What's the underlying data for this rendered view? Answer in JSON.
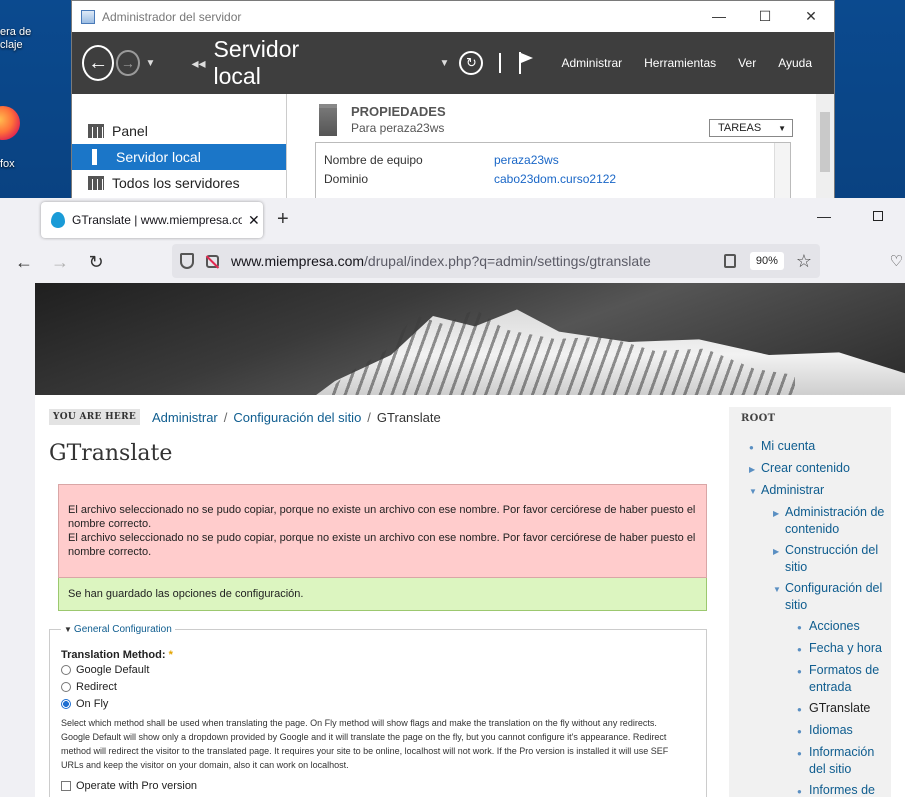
{
  "desktop": {
    "icon1_label_line1": "era de",
    "icon1_label_line2": "claje",
    "icon2_label": "fox"
  },
  "server_manager": {
    "window_title": "Administrador del servidor",
    "window_controls": [
      "—",
      "☐",
      "✕"
    ],
    "breadcrumb": "Servidor local",
    "menu": [
      "Administrar",
      "Herramientas",
      "Ver",
      "Ayuda"
    ],
    "sidebar": [
      {
        "label": "Panel",
        "active": false
      },
      {
        "label": "Servidor local",
        "active": true
      },
      {
        "label": "Todos los servidores",
        "active": false
      }
    ],
    "properties_title": "PROPIEDADES",
    "properties_subtitle": "Para peraza23ws",
    "tasks_label": "TAREAS",
    "properties": [
      {
        "key": "Nombre de equipo",
        "value": "peraza23ws"
      },
      {
        "key": "Dominio",
        "value": "cabo23dom.curso2122"
      }
    ]
  },
  "browser": {
    "tab_title": "GTranslate | www.miempresa.com",
    "url_host": "www.miempresa.com",
    "url_path": "/drupal/index.php?q=admin/settings/gtranslate",
    "zoom": "90%"
  },
  "page": {
    "you_are_here": "YOU ARE HERE",
    "breadcrumb": [
      "Administrar",
      "Configuración del sitio"
    ],
    "breadcrumb_current": "GTranslate",
    "title": "GTranslate",
    "error_messages": [
      "El archivo seleccionado no se pudo copiar, porque no existe un archivo con ese nombre. Por favor cerciórese de haber puesto el nombre correcto.",
      "El archivo seleccionado no se pudo copiar, porque no existe un archivo con ese nombre. Por favor cerciórese de haber puesto el nombre correcto."
    ],
    "status_message": "Se han guardado las opciones de configuración.",
    "fieldset_legend": "General Configuration",
    "translation_method_label": "Translation Method:",
    "required_marker": "*",
    "methods": [
      {
        "label": "Google Default",
        "selected": false
      },
      {
        "label": "Redirect",
        "selected": false
      },
      {
        "label": "On Fly",
        "selected": true
      }
    ],
    "method_description": "Select which method shall be used when translating the page. On Fly method will show flags and make the translation on the fly without any redirects. Google Default will show only a dropdown provided by Google and it will translate the page on the fly, but you cannot configure it's appearance. Redirect method will redirect the visitor to the translated page. It requires your site to be online, localhost will not work. If the Pro version is installed it will use SEF URLs and keep the visitor on your domain, also it can work on localhost.",
    "next_checkbox_label": "Operate with Pro version"
  },
  "sidebar": {
    "root": "ROOT",
    "items": [
      {
        "label": "Mi cuenta",
        "marker": "●",
        "level": 0
      },
      {
        "label": "Crear contenido",
        "marker": "▶",
        "level": 0
      },
      {
        "label": "Administrar",
        "marker": "▼",
        "level": 0
      },
      {
        "label": "Administración de contenido",
        "marker": "▶",
        "level": 1
      },
      {
        "label": "Construcción del sitio",
        "marker": "▶",
        "level": 1
      },
      {
        "label": "Configuración del sitio",
        "marker": "▼",
        "level": 1
      },
      {
        "label": "Acciones",
        "marker": "●",
        "level": 2
      },
      {
        "label": "Fecha y hora",
        "marker": "●",
        "level": 2
      },
      {
        "label": "Formatos de entrada",
        "marker": "●",
        "level": 2
      },
      {
        "label": "GTranslate",
        "marker": "●",
        "level": 2,
        "current": true
      },
      {
        "label": "Idiomas",
        "marker": "●",
        "level": 2
      },
      {
        "label": "Información del sitio",
        "marker": "●",
        "level": 2
      },
      {
        "label": "Informes de",
        "marker": "●",
        "level": 2
      }
    ]
  }
}
